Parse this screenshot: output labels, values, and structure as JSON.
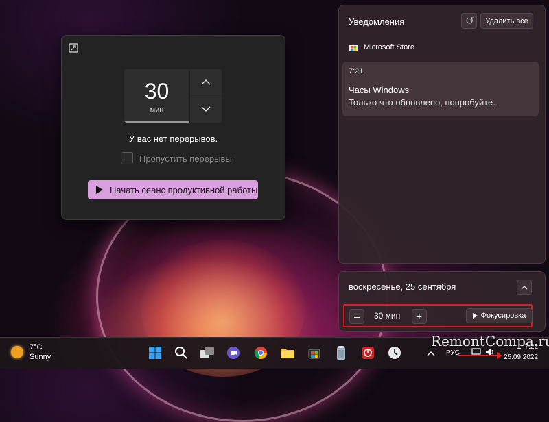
{
  "focus_widget": {
    "timer_value": "30",
    "timer_unit": "мин",
    "no_breaks_text": "У вас нет перерывов.",
    "skip_breaks_label": "Пропустить перерывы",
    "start_button_label": "Начать сеанс продуктивной работы",
    "accent_color": "#d99fde"
  },
  "notifications": {
    "title": "Уведомления",
    "clear_all_label": "Удалить все",
    "app_name": "Microsoft Store",
    "card": {
      "time": "7:21",
      "title": "Часы Windows",
      "body": "Только что обновлено, попробуйте."
    }
  },
  "calendar": {
    "date_label": "воскресенье, 25 сентября",
    "focus_time": "30 мин",
    "focus_button_label": "Фокусировка",
    "minus_label": "–",
    "plus_label": "+"
  },
  "taskbar": {
    "weather_temp": "7°C",
    "weather_desc": "Sunny",
    "language": "РУС",
    "clock_time": "7:22",
    "clock_date": "25.09.2022",
    "icons": [
      "windows-start-icon",
      "search-icon",
      "task-view-icon",
      "teams-chat-icon",
      "chrome-icon",
      "file-explorer-icon",
      "store-icon",
      "recycle-icon",
      "app-icon",
      "clock-app-icon"
    ]
  },
  "watermark": "RemontCompa.ru",
  "highlight_color": "#e11c1c"
}
